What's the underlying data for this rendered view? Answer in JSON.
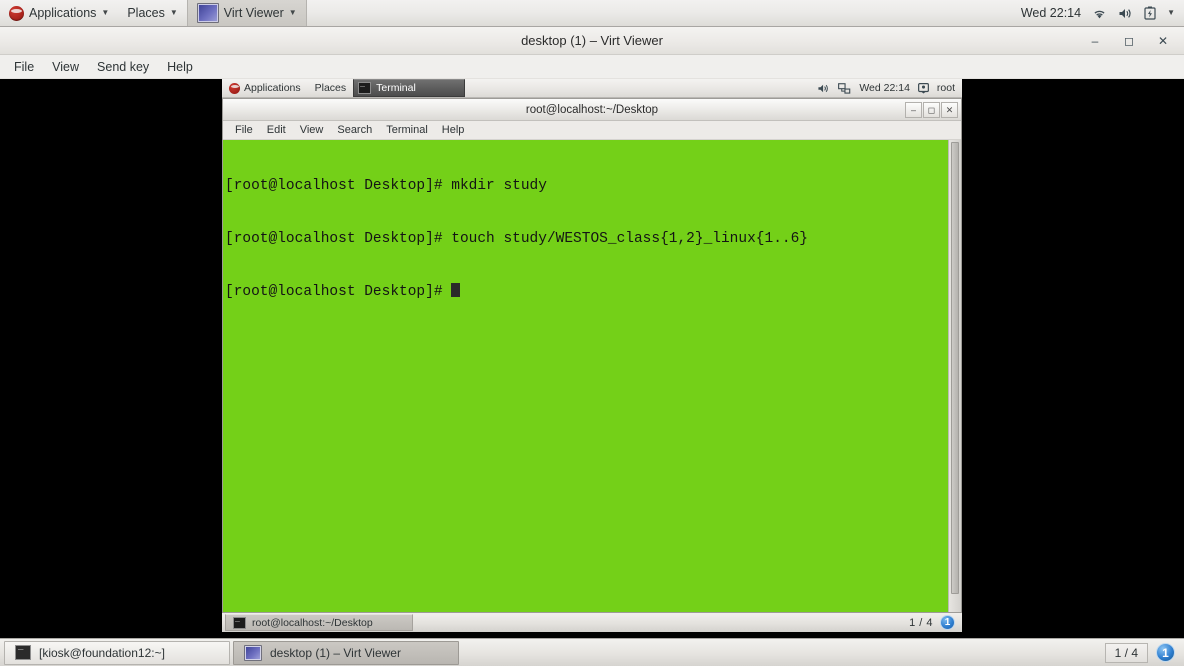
{
  "host_top_panel": {
    "applications_label": "Applications",
    "places_label": "Places",
    "virt_viewer_label": "Virt Viewer",
    "clock": "Wed 22:14"
  },
  "virt_viewer_window": {
    "title": "desktop (1) – Virt Viewer",
    "window_buttons": {
      "minimize": "–",
      "maximize": "◻",
      "close": "✕"
    },
    "menubar": [
      "File",
      "View",
      "Send key",
      "Help"
    ]
  },
  "vm_top_panel": {
    "applications_label": "Applications",
    "places_label": "Places",
    "window_button_label": "Terminal",
    "clock": "Wed 22:14",
    "user": "root"
  },
  "terminal": {
    "title": "root@localhost:~/Desktop",
    "window_buttons": {
      "minimize": "–",
      "maximize": "◻",
      "close": "✕"
    },
    "menubar": [
      "File",
      "Edit",
      "View",
      "Search",
      "Terminal",
      "Help"
    ],
    "background_color": "#74d018",
    "foreground_color": "#141414",
    "lines": [
      "[root@localhost Desktop]# mkdir study",
      "[root@localhost Desktop]# touch study/WESTOS_class{1,2}_linux{1..6}",
      "[root@localhost Desktop]# "
    ]
  },
  "vm_bottom_panel": {
    "window_button_label": "root@localhost:~/Desktop",
    "workspace_indicator": "1 / 4",
    "workspace_number": "1"
  },
  "host_bottom_panel": {
    "tasks": [
      {
        "label": "[kiosk@foundation12:~]",
        "active": false
      },
      {
        "label": "desktop (1) – Virt Viewer",
        "active": true
      }
    ],
    "workspace_indicator": "1 / 4",
    "workspace_number": "1"
  }
}
